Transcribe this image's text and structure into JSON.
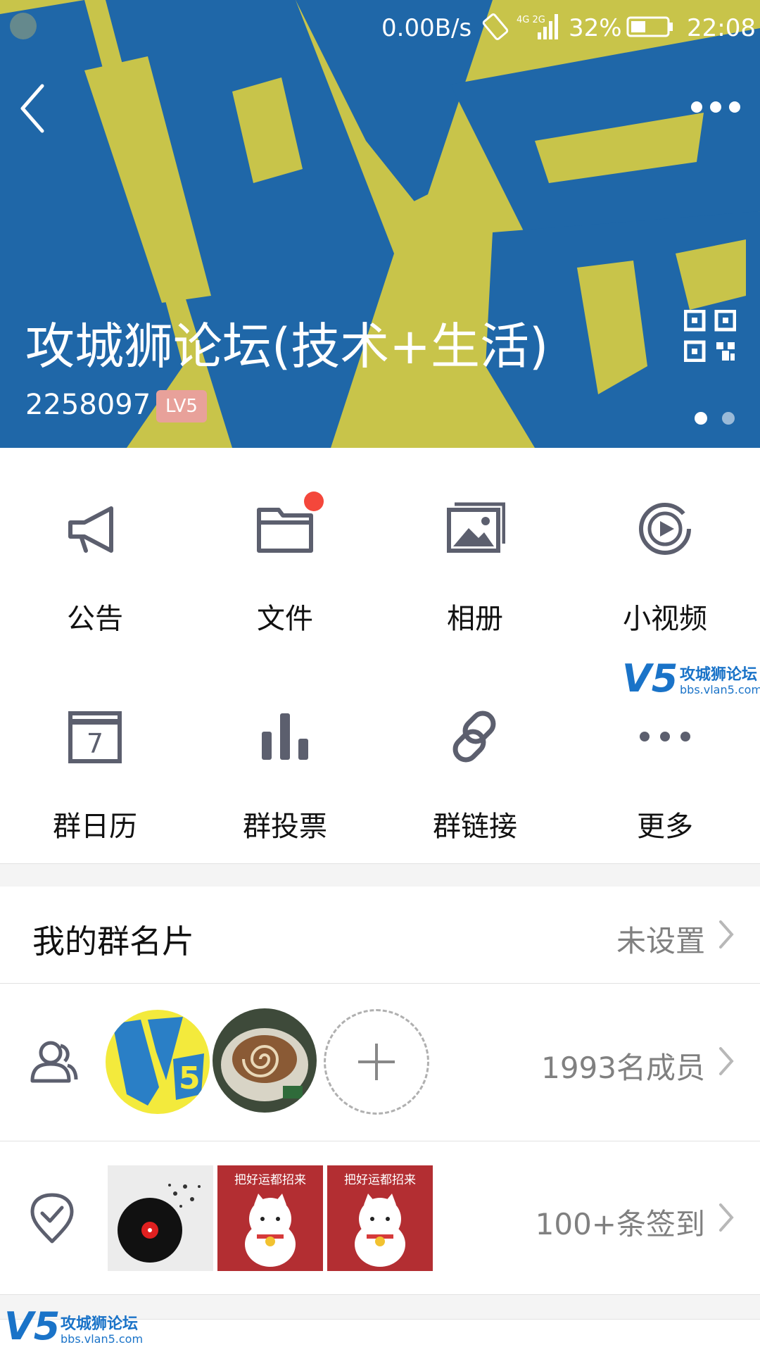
{
  "status_bar": {
    "net_speed": "0.00B/s",
    "network": "4G 2G",
    "battery_pct": "32%",
    "time": "22:08"
  },
  "header": {
    "group_name": "攻城狮论坛(技术+生活)",
    "group_id": "2258097",
    "level": "LV5",
    "pages": 2,
    "current_page": 1
  },
  "features": [
    {
      "label": "公告",
      "icon": "megaphone-icon"
    },
    {
      "label": "文件",
      "icon": "folder-icon",
      "badge": true
    },
    {
      "label": "相册",
      "icon": "album-icon"
    },
    {
      "label": "小视频",
      "icon": "video-icon"
    },
    {
      "label": "群日历",
      "icon": "calendar-icon",
      "calendar_day": "7"
    },
    {
      "label": "群投票",
      "icon": "poll-icon"
    },
    {
      "label": "群链接",
      "icon": "link-icon"
    },
    {
      "label": "更多",
      "icon": "more-icon"
    }
  ],
  "group_card": {
    "title": "我的群名片",
    "value": "未设置"
  },
  "members": {
    "count_text": "1993名成员"
  },
  "checkins": {
    "count_text": "100+条签到",
    "thumb_text": "把好运都招来"
  },
  "watermark": {
    "logo": "V5",
    "name": "攻城狮论坛",
    "url": "bbs.vlan5.com"
  },
  "colors": {
    "banner_yellow": "#c8c44a",
    "banner_blue": "#1f67a8",
    "icon_gray": "#5c5f6e",
    "badge_red": "#f4473b",
    "lv_badge": "#e8a19a"
  }
}
